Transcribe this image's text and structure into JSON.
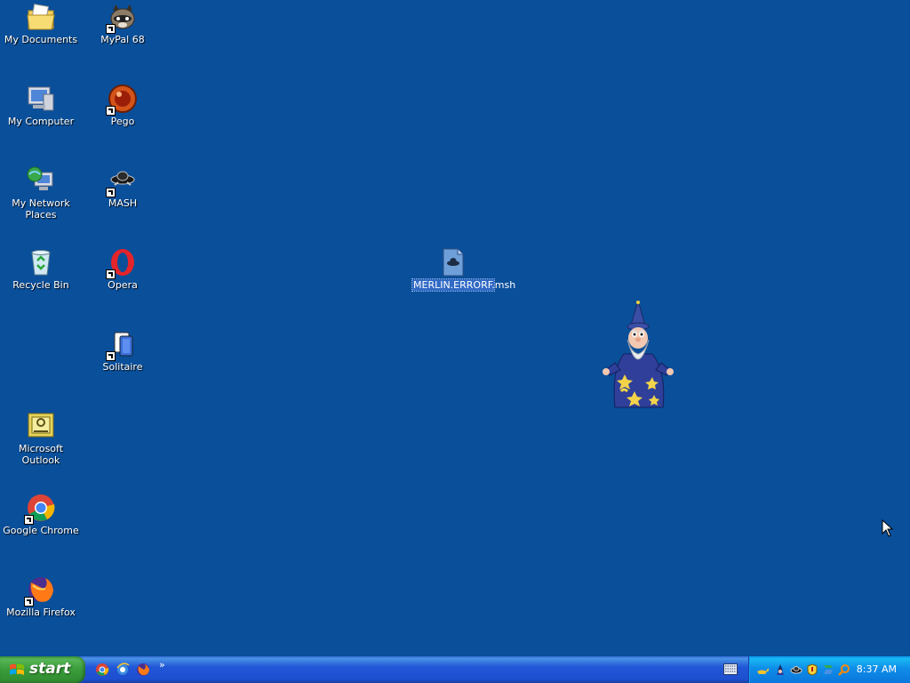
{
  "desktop": {
    "icons": [
      {
        "label": "My Documents"
      },
      {
        "label": "My Computer"
      },
      {
        "label": "My Network Places"
      },
      {
        "label": "Recycle Bin"
      },
      {
        "label": "Microsoft Outlook"
      },
      {
        "label": "Google Chrome"
      },
      {
        "label": "Mozilla Firefox"
      },
      {
        "label": "MyPal 68"
      },
      {
        "label": "Pego"
      },
      {
        "label": "MASH"
      },
      {
        "label": "Opera"
      },
      {
        "label": "Solitaire"
      },
      {
        "label": "MERLIN.ERRORF.msh"
      }
    ],
    "background_color": "#0a4f9a"
  },
  "taskbar": {
    "start_label": "start",
    "quick_launch_overflow": "»",
    "tray": {
      "clock": "8:37 AM"
    }
  }
}
